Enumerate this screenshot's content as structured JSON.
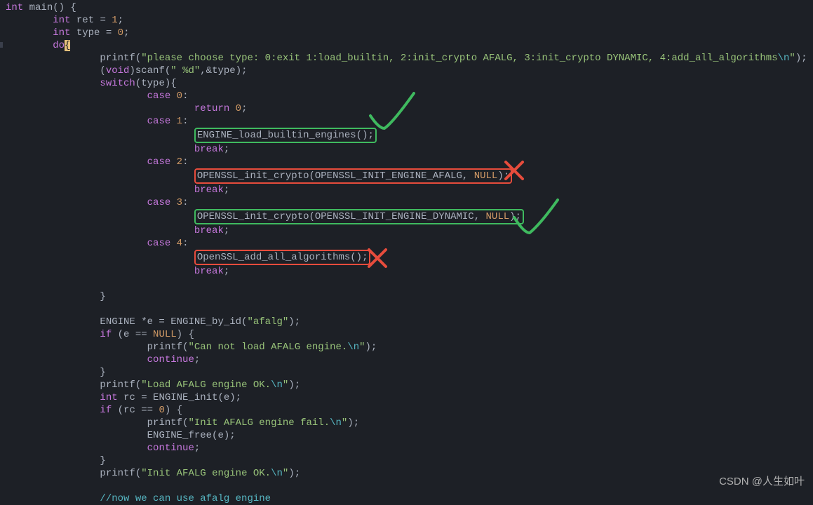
{
  "code": {
    "line1_int": "int",
    "line1_main": " main() {",
    "line2_int": "int",
    "line2_rest": " ret = ",
    "line2_val": "1",
    "line3_int": "int",
    "line3_rest": " type = ",
    "line3_val": "0",
    "line4_do": "do",
    "line5_printf": "printf",
    "line5_str": "\"please choose type: 0:exit 1:load_builtin, 2:init_crypto AFALG, 3:init_crypto DYNAMIC, 4:add_all_algorithms",
    "line5_esc": "\\n",
    "line5_end": "\"",
    "line6_void": "void",
    "line6_scanf": "scanf",
    "line6_fmt": "\" %d\"",
    "line6_rest": ",&type);",
    "line7_switch": "switch",
    "line7_rest": "(type){",
    "case0_kw": "case",
    "case0_n": "0",
    "case0_ret": "return",
    "case0_rv": "0",
    "case1_kw": "case",
    "case1_n": "1",
    "case1_call": "ENGINE_load_builtin_engines();",
    "break_kw": "break",
    "case2_kw": "case",
    "case2_n": "2",
    "case2_fn": "OPENSSL_init_crypto(OPENSSL_INIT_ENGINE_AFALG, ",
    "case2_null": "NULL",
    "case2_end": ");",
    "case3_kw": "case",
    "case3_n": "3",
    "case3_fn": "OPENSSL_init_crypto(OPENSSL_INIT_ENGINE_DYNAMIC, ",
    "case3_null": "NULL",
    "case3_end": ");",
    "case4_kw": "case",
    "case4_n": "4",
    "case4_call": "OpenSSL_add_all_algorithms();",
    "engine_decl": "ENGINE *e = ENGINE_by_id(",
    "engine_arg": "\"afalg\"",
    "engine_end": ");",
    "if_kw": "if",
    "if1_cond": " (e == ",
    "if1_null": "NULL",
    "if1_end": ") {",
    "printf_noload": "\"Can not load AFALG engine.",
    "printf_end": "\"",
    "continue_kw": "continue",
    "printf_loadok": "\"Load AFALG engine OK.",
    "rc_decl": " rc = ENGINE_init(e);",
    "if2_cond": " (rc == ",
    "if2_zero": "0",
    "if2_end": ") {",
    "printf_initfail": "\"Init AFALG engine fail.",
    "engine_free": "ENGINE_free(e);",
    "printf_initok": "\"Init AFALG engine OK.",
    "comment": "//now we can use afalg engine"
  },
  "annotations": {
    "check1_color": "#3fba5f",
    "x1_color": "#e74c3c",
    "check2_color": "#3fba5f",
    "x2_color": "#e74c3c"
  },
  "watermark": "CSDN @人生如叶"
}
